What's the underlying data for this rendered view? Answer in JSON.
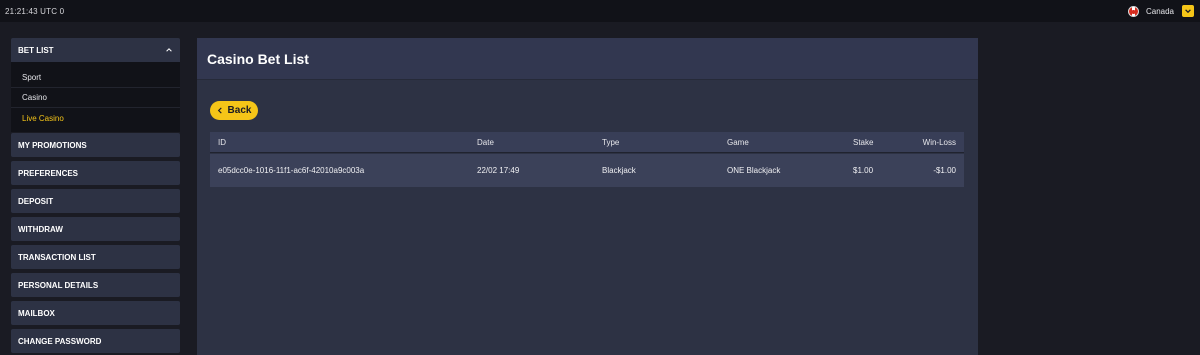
{
  "topbar": {
    "clock": "21:21:43 UTC 0",
    "country": "Canada"
  },
  "sidebar": {
    "header": "BET LIST",
    "subitems": [
      {
        "label": "Sport",
        "active": false
      },
      {
        "label": "Casino",
        "active": false
      },
      {
        "label": "Live Casino",
        "active": true
      }
    ],
    "items": [
      {
        "label": "MY PROMOTIONS"
      },
      {
        "label": "PREFERENCES"
      },
      {
        "label": "DEPOSIT"
      },
      {
        "label": "WITHDRAW"
      },
      {
        "label": "TRANSACTION LIST"
      },
      {
        "label": "PERSONAL DETAILS"
      },
      {
        "label": "MAILBOX"
      },
      {
        "label": "CHANGE PASSWORD"
      }
    ]
  },
  "main": {
    "title": "Casino Bet List",
    "back_label": "Back",
    "columns": [
      "ID",
      "Date",
      "Type",
      "Game",
      "Stake",
      "Win-Loss"
    ],
    "rows": [
      {
        "id": "e05dcc0e-1016-11f1-ac6f-42010a9c003a",
        "date": "22/02 17:49",
        "type": "Blackjack",
        "game": "ONE Blackjack",
        "stake": "$1.00",
        "win_loss": "-$1.00"
      }
    ]
  },
  "colors": {
    "accent": "#f5c518",
    "background": "#1a1b23",
    "panel": "#2d3244"
  }
}
